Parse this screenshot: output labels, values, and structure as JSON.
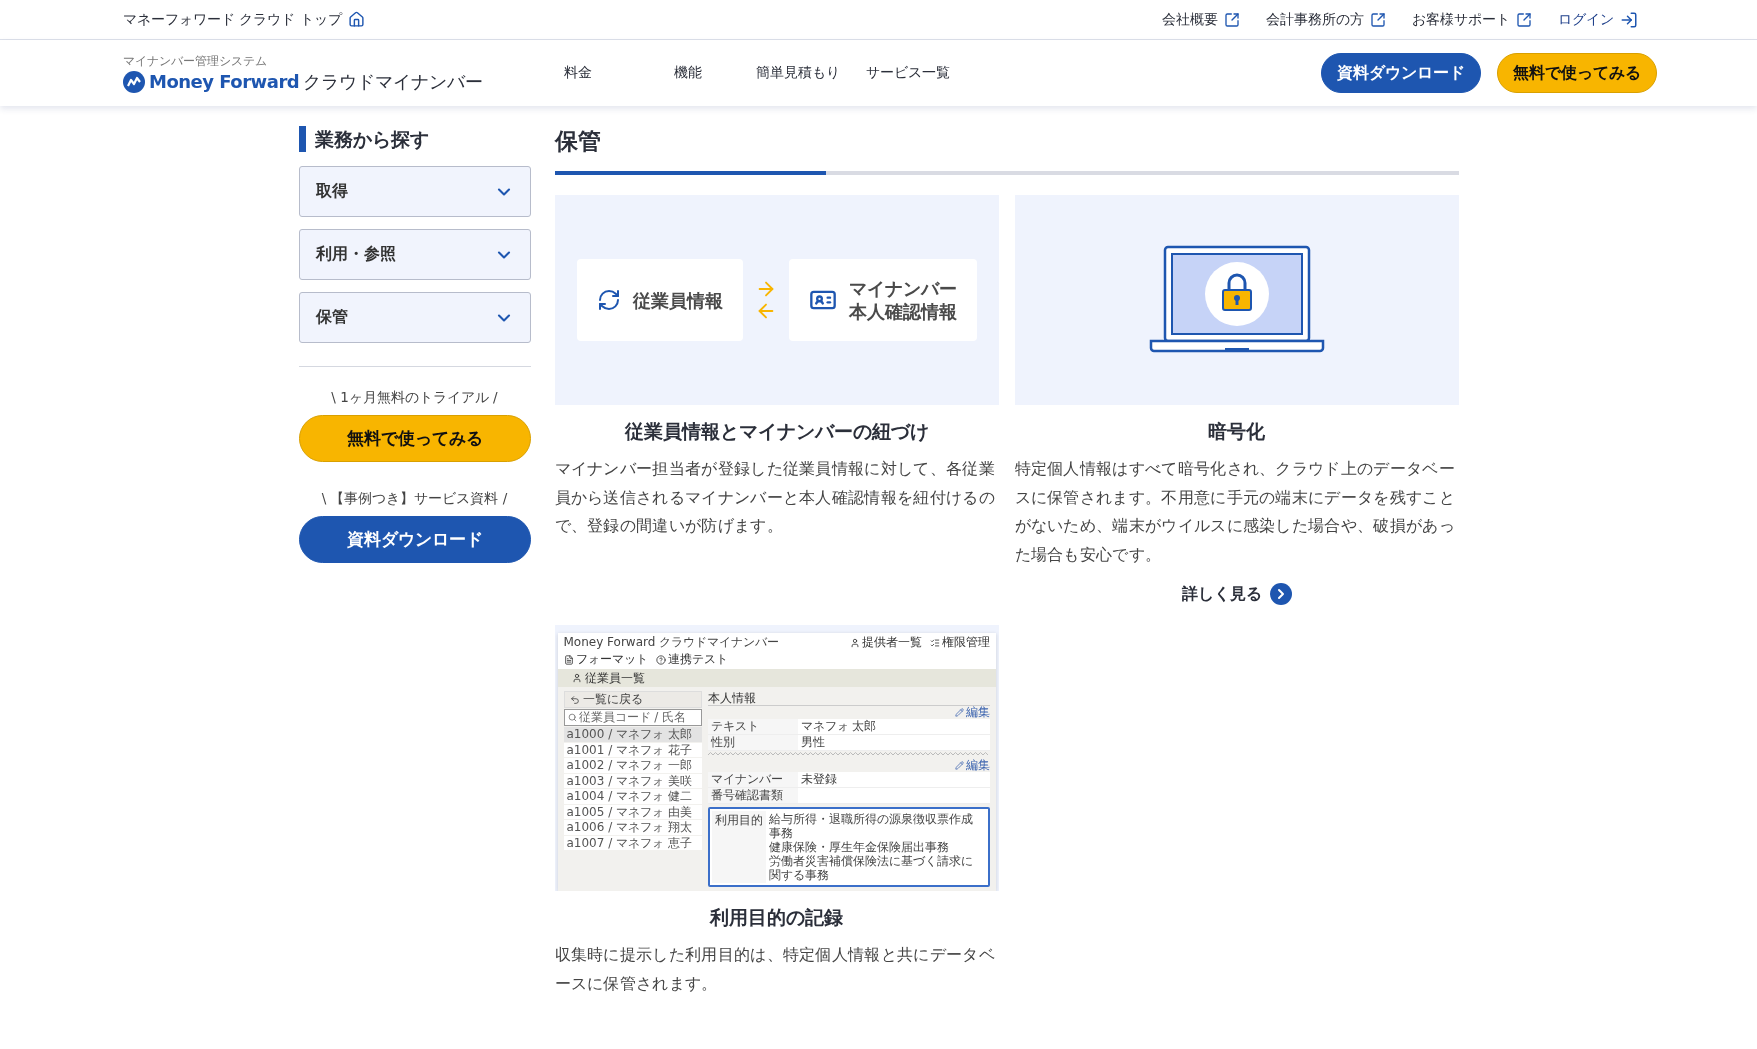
{
  "top_bar": {
    "home_link": "マネーフォワード クラウド トップ",
    "links": [
      {
        "label": "会社概要",
        "kind": "external"
      },
      {
        "label": "会計事務所の方",
        "kind": "external"
      },
      {
        "label": "お客様サポート",
        "kind": "external"
      },
      {
        "label": "ログイン",
        "kind": "login"
      }
    ]
  },
  "header": {
    "logo": {
      "subtitle": "マイナンバー管理システム",
      "brand": "Money Forward",
      "product": "クラウドマイナンバー"
    },
    "nav": [
      "料金",
      "機能",
      "簡単見積もり",
      "サービス一覧"
    ],
    "buttons": [
      {
        "label": "資料ダウンロード",
        "kind": "primary"
      },
      {
        "label": "無料で使ってみる",
        "kind": "accent"
      }
    ]
  },
  "sidebar": {
    "heading": "業務から探す",
    "categories": [
      {
        "label": "取得",
        "expanded": false
      },
      {
        "label": "利用・参照",
        "expanded": false
      },
      {
        "label": "保管",
        "expanded": false
      }
    ],
    "cta": [
      {
        "caption": "\\ 1ヶ月無料のトライアル /",
        "label": "無料で使ってみる",
        "kind": "accent"
      },
      {
        "caption": "\\ 【事例つき】サービス資料 /",
        "label": "資料ダウンロード",
        "kind": "primary"
      }
    ]
  },
  "section": {
    "title": "保管",
    "cards": [
      {
        "kind": "link-diagram",
        "left_label": "従業員情報",
        "right_lines": [
          "マイナンバー",
          "本人確認情報"
        ],
        "title": "従業員情報とマイナンバーの紐づけ",
        "text": "マイナンバー担当者が登録した従業員情報に対して、各従業員から送信されるマイナンバーと本人確認情報を紐付けるので、登録の間違いが防げます。"
      },
      {
        "kind": "encryption",
        "title": "暗号化",
        "text": "特定個人情報はすべて暗号化され、クラウド上のデータベースに保管されます。不用意に手元の端末にデータを残すことがないため、端末がウイルスに感染した場合や、破損があった場合も安心です。",
        "link": "詳しく見る"
      },
      {
        "kind": "app-screenshot",
        "title": "利用目的の記録",
        "text": "収集時に提示した利用目的は、特定個人情報と共にデータベースに保管されます。",
        "app": {
          "brand": "Money Forward",
          "product": "クラウドマイナンバー",
          "nav": [
            "提供者一覧",
            "権限管理",
            "フォーマット",
            "連携テスト"
          ],
          "page_title": "従業員一覧",
          "back": "一覧に戻る",
          "search_placeholder": "従業員コード / 氏名",
          "employees": [
            {
              "label": "a1000 / マネフォ 太郎",
              "selected": true
            },
            {
              "label": "a1001 / マネフォ 花子",
              "selected": false
            },
            {
              "label": "a1002 / マネフォ 一郎",
              "selected": false
            },
            {
              "label": "a1003 / マネフォ 美咲",
              "selected": false
            },
            {
              "label": "a1004 / マネフォ 健二",
              "selected": false
            },
            {
              "label": "a1005 / マネフォ 由美",
              "selected": false
            },
            {
              "label": "a1006 / マネフォ 翔太",
              "selected": false
            },
            {
              "label": "a1007 / マネフォ 恵子",
              "selected": false
            }
          ],
          "panel_title": "本人情報",
          "edit": "編集",
          "edit2": "編集",
          "fields": [
            {
              "label": "テキスト",
              "value": "マネフォ 太郎"
            },
            {
              "label": "性別",
              "value": "男性"
            }
          ],
          "fields2": [
            {
              "label": "マイナンバー",
              "value": "未登録"
            },
            {
              "label": "番号確認書類"
            }
          ],
          "purpose_label": "利用目的",
          "purposes": [
            "給与所得・退職所得の源泉徴収票作成事務",
            "健康保険・厚生年金保険届出事務",
            "労働者災害補償保険法に基づく請求に関する事務"
          ]
        }
      }
    ]
  }
}
